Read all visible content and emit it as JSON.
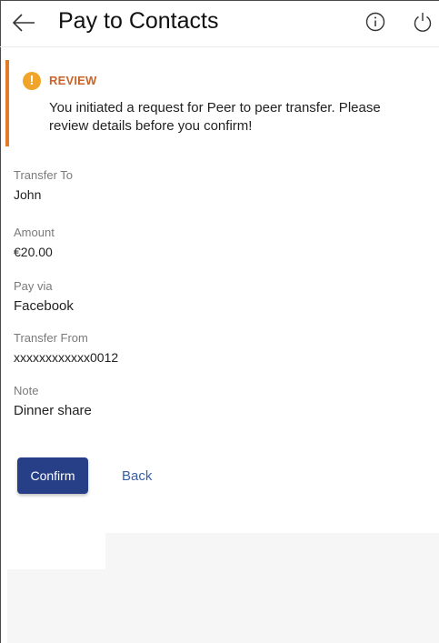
{
  "header": {
    "title": "Pay to Contacts",
    "icons": {
      "back": "back-arrow-icon",
      "info": "info-icon",
      "power": "power-icon"
    }
  },
  "review": {
    "title": "REVIEW",
    "message": "You initiated a request for Peer to peer transfer. Please review details before you confirm!",
    "icon": "warning-icon",
    "accent_color": "#e07b2a",
    "icon_color": "#f0a52a"
  },
  "details": {
    "transfer_to": {
      "label": "Transfer To",
      "value": "John"
    },
    "amount": {
      "label": "Amount",
      "value": "€20.00"
    },
    "pay_via": {
      "label": "Pay via",
      "value": "Facebook"
    },
    "transfer_from": {
      "label": "Transfer From",
      "value": "xxxxxxxxxxxx0012"
    },
    "note": {
      "label": "Note",
      "value": "Dinner share"
    }
  },
  "actions": {
    "confirm_label": "Confirm",
    "back_label": "Back",
    "primary_color": "#263f86",
    "link_color": "#3a5fa8"
  }
}
